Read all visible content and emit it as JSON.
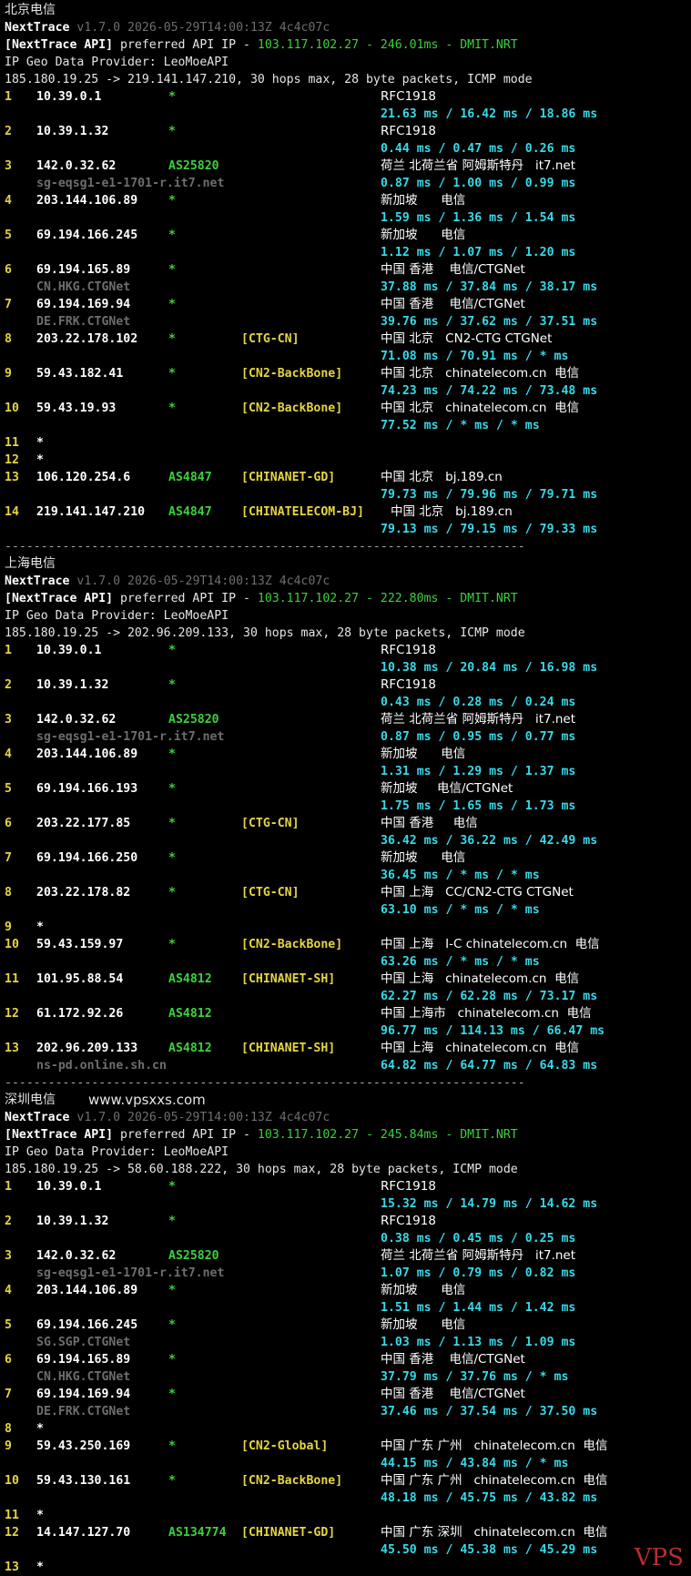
{
  "watermark_url": "www.vpsxxs.com",
  "watermark_brand": "VPS",
  "sections": [
    {
      "label": "北京电信",
      "version": "v1.7.0 2026-05-29T14:00:13Z 4c4c07c",
      "api_ip": "103.117.102.27",
      "api_latency": "246.01ms",
      "api_pop": "DMIT.NRT",
      "provider": "IP Geo Data Provider: LeoMoeAPI",
      "target": "185.180.19.25 -> 219.141.147.210, 30 hops max, 28 byte packets, ICMP mode",
      "hops": [
        {
          "n": "1",
          "ip": "10.39.0.1",
          "as": "*",
          "tag": "",
          "geo": "RFC1918",
          "rdns": "",
          "rtt": "21.63 ms / 16.42 ms / 18.86 ms"
        },
        {
          "n": "2",
          "ip": "10.39.1.32",
          "as": "*",
          "tag": "",
          "geo": "RFC1918",
          "rdns": "",
          "rtt": "0.44 ms / 0.47 ms / 0.26 ms"
        },
        {
          "n": "3",
          "ip": "142.0.32.62",
          "as": "AS25820",
          "tag": "",
          "geo": "荷兰 北荷兰省 阿姆斯特丹   it7.net",
          "rdns": "sg-eqsg1-e1-1701-r.it7.net",
          "rtt": "0.87 ms / 1.00 ms / 0.99 ms"
        },
        {
          "n": "4",
          "ip": "203.144.106.89",
          "as": "*",
          "tag": "",
          "geo": "新加坡      电信",
          "rdns": "",
          "rtt": "1.59 ms / 1.36 ms / 1.54 ms"
        },
        {
          "n": "5",
          "ip": "69.194.166.245",
          "as": "*",
          "tag": "",
          "geo": "新加坡      电信",
          "rdns": "",
          "rtt": "1.12 ms / 1.07 ms / 1.20 ms"
        },
        {
          "n": "6",
          "ip": "69.194.165.89",
          "as": "*",
          "tag": "",
          "geo": "中国 香港    电信/CTGNet",
          "rdns": "CN.HKG.CTGNet",
          "rtt": "37.88 ms / 37.84 ms / 38.17 ms"
        },
        {
          "n": "7",
          "ip": "69.194.169.94",
          "as": "*",
          "tag": "",
          "geo": "中国 香港    电信/CTGNet",
          "rdns": "DE.FRK.CTGNet",
          "rtt": "39.76 ms / 37.62 ms / 37.51 ms"
        },
        {
          "n": "8",
          "ip": "203.22.178.102",
          "as": "*",
          "tag": "[CTG-CN]",
          "geo": "中国 北京   CN2-CTG CTGNet",
          "rdns": "",
          "rtt": "71.08 ms / 70.91 ms / * ms"
        },
        {
          "n": "9",
          "ip": "59.43.182.41",
          "as": "*",
          "tag": "[CN2-BackBone]",
          "geo": "中国 北京   chinatelecom.cn  电信",
          "rdns": "",
          "rtt": "74.23 ms / 74.22 ms / 73.48 ms"
        },
        {
          "n": "10",
          "ip": "59.43.19.93",
          "as": "*",
          "tag": "[CN2-BackBone]",
          "geo": "中国 北京   chinatelecom.cn  电信",
          "rdns": "",
          "rtt": "77.52 ms / * ms / * ms"
        },
        {
          "n": "11",
          "ip": "*",
          "as": "",
          "tag": "",
          "geo": "",
          "rdns": "",
          "rtt": ""
        },
        {
          "n": "12",
          "ip": "*",
          "as": "",
          "tag": "",
          "geo": "",
          "rdns": "",
          "rtt": ""
        },
        {
          "n": "13",
          "ip": "106.120.254.6",
          "as": "AS4847",
          "tag": "[CHINANET-GD]",
          "geo": "中国 北京   bj.189.cn",
          "rdns": "",
          "rtt": "79.73 ms / 79.96 ms / 79.71 ms"
        },
        {
          "n": "14",
          "ip": "219.141.147.210",
          "as": "AS4847",
          "tag": "[CHINATELECOM-BJ]",
          "geo": "中国 北京   bj.189.cn",
          "rdns": "",
          "rtt": "79.13 ms / 79.15 ms / 79.33 ms"
        }
      ]
    },
    {
      "label": "上海电信",
      "version": "v1.7.0 2026-05-29T14:00:13Z 4c4c07c",
      "api_ip": "103.117.102.27",
      "api_latency": "222.80ms",
      "api_pop": "DMIT.NRT",
      "provider": "IP Geo Data Provider: LeoMoeAPI",
      "target": "185.180.19.25 -> 202.96.209.133, 30 hops max, 28 byte packets, ICMP mode",
      "hops": [
        {
          "n": "1",
          "ip": "10.39.0.1",
          "as": "*",
          "tag": "",
          "geo": "RFC1918",
          "rdns": "",
          "rtt": "10.38 ms / 20.84 ms / 16.98 ms"
        },
        {
          "n": "2",
          "ip": "10.39.1.32",
          "as": "*",
          "tag": "",
          "geo": "RFC1918",
          "rdns": "",
          "rtt": "0.43 ms / 0.28 ms / 0.24 ms"
        },
        {
          "n": "3",
          "ip": "142.0.32.62",
          "as": "AS25820",
          "tag": "",
          "geo": "荷兰 北荷兰省 阿姆斯特丹   it7.net",
          "rdns": "sg-eqsg1-e1-1701-r.it7.net",
          "rtt": "0.87 ms / 0.95 ms / 0.77 ms"
        },
        {
          "n": "4",
          "ip": "203.144.106.89",
          "as": "*",
          "tag": "",
          "geo": "新加坡      电信",
          "rdns": "",
          "rtt": "1.31 ms / 1.29 ms / 1.37 ms"
        },
        {
          "n": "5",
          "ip": "69.194.166.193",
          "as": "*",
          "tag": "",
          "geo": "新加坡     电信/CTGNet",
          "rdns": "",
          "rtt": "1.75 ms / 1.65 ms / 1.73 ms"
        },
        {
          "n": "6",
          "ip": "203.22.177.85",
          "as": "*",
          "tag": "[CTG-CN]",
          "geo": "中国 香港     电信",
          "rdns": "",
          "rtt": "36.42 ms / 36.22 ms / 42.49 ms"
        },
        {
          "n": "7",
          "ip": "69.194.166.250",
          "as": "*",
          "tag": "",
          "geo": "新加坡      电信",
          "rdns": "",
          "rtt": "36.45 ms / * ms / * ms"
        },
        {
          "n": "8",
          "ip": "203.22.178.82",
          "as": "*",
          "tag": "[CTG-CN]",
          "geo": "中国 上海   CC/CN2-CTG CTGNet",
          "rdns": "",
          "rtt": "63.10 ms / * ms / * ms"
        },
        {
          "n": "9",
          "ip": "*",
          "as": "",
          "tag": "",
          "geo": "",
          "rdns": "",
          "rtt": ""
        },
        {
          "n": "10",
          "ip": "59.43.159.97",
          "as": "*",
          "tag": "[CN2-BackBone]",
          "geo": "中国 上海   I-C chinatelecom.cn  电信",
          "rdns": "",
          "rtt": "63.26 ms / * ms / * ms"
        },
        {
          "n": "11",
          "ip": "101.95.88.54",
          "as": "AS4812",
          "tag": "[CHINANET-SH]",
          "geo": "中国 上海   chinatelecom.cn  电信",
          "rdns": "",
          "rtt": "62.27 ms / 62.28 ms / 73.17 ms"
        },
        {
          "n": "12",
          "ip": "61.172.92.26",
          "as": "AS4812",
          "tag": "",
          "geo": "中国 上海市   chinatelecom.cn  电信",
          "rdns": "",
          "rtt": "96.77 ms / 114.13 ms / 66.47 ms"
        },
        {
          "n": "13",
          "ip": "202.96.209.133",
          "as": "AS4812",
          "tag": "[CHINANET-SH]",
          "geo": "中国 上海   chinatelecom.cn  电信",
          "rdns": "ns-pd.online.sh.cn",
          "rtt": "64.82 ms / 64.77 ms / 64.83 ms"
        }
      ]
    },
    {
      "label": "深圳电信",
      "version": "v1.7.0 2026-05-29T14:00:13Z 4c4c07c",
      "api_ip": "103.117.102.27",
      "api_latency": "245.84ms",
      "api_pop": "DMIT.NRT",
      "provider": "IP Geo Data Provider: LeoMoeAPI",
      "target": "185.180.19.25 -> 58.60.188.222, 30 hops max, 28 byte packets, ICMP mode",
      "hops": [
        {
          "n": "1",
          "ip": "10.39.0.1",
          "as": "*",
          "tag": "",
          "geo": "RFC1918",
          "rdns": "",
          "rtt": "15.32 ms / 14.79 ms / 14.62 ms"
        },
        {
          "n": "2",
          "ip": "10.39.1.32",
          "as": "*",
          "tag": "",
          "geo": "RFC1918",
          "rdns": "",
          "rtt": "0.38 ms / 0.45 ms / 0.25 ms"
        },
        {
          "n": "3",
          "ip": "142.0.32.62",
          "as": "AS25820",
          "tag": "",
          "geo": "荷兰 北荷兰省 阿姆斯特丹   it7.net",
          "rdns": "sg-eqsg1-e1-1701-r.it7.net",
          "rtt": "1.07 ms / 0.79 ms / 0.82 ms"
        },
        {
          "n": "4",
          "ip": "203.144.106.89",
          "as": "*",
          "tag": "",
          "geo": "新加坡      电信",
          "rdns": "",
          "rtt": "1.51 ms / 1.44 ms / 1.42 ms"
        },
        {
          "n": "5",
          "ip": "69.194.166.245",
          "as": "*",
          "tag": "",
          "geo": "新加坡      电信",
          "rdns": "SG.SGP.CTGNet",
          "rtt": "1.03 ms / 1.13 ms / 1.09 ms"
        },
        {
          "n": "6",
          "ip": "69.194.165.89",
          "as": "*",
          "tag": "",
          "geo": "中国 香港    电信/CTGNet",
          "rdns": "CN.HKG.CTGNet",
          "rtt": "37.79 ms / 37.76 ms / * ms"
        },
        {
          "n": "7",
          "ip": "69.194.169.94",
          "as": "*",
          "tag": "",
          "geo": "中国 香港    电信/CTGNet",
          "rdns": "DE.FRK.CTGNet",
          "rtt": "37.46 ms / 37.54 ms / 37.50 ms"
        },
        {
          "n": "8",
          "ip": "*",
          "as": "",
          "tag": "",
          "geo": "",
          "rdns": "",
          "rtt": ""
        },
        {
          "n": "9",
          "ip": "59.43.250.169",
          "as": "*",
          "tag": "[CN2-Global]",
          "geo": "中国 广东 广州   chinatelecom.cn  电信",
          "rdns": "",
          "rtt": "44.15 ms / 43.84 ms / * ms"
        },
        {
          "n": "10",
          "ip": "59.43.130.161",
          "as": "*",
          "tag": "[CN2-BackBone]",
          "geo": "中国 广东 广州   chinatelecom.cn  电信",
          "rdns": "",
          "rtt": "48.18 ms / 45.75 ms / 43.82 ms"
        },
        {
          "n": "11",
          "ip": "*",
          "as": "",
          "tag": "",
          "geo": "",
          "rdns": "",
          "rtt": ""
        },
        {
          "n": "12",
          "ip": "14.147.127.70",
          "as": "AS134774",
          "tag": "[CHINANET-GD]",
          "geo": "中国 广东 深圳   chinatelecom.cn  电信",
          "rdns": "",
          "rtt": "45.50 ms / 45.38 ms / 45.29 ms"
        },
        {
          "n": "13",
          "ip": "*",
          "as": "",
          "tag": "",
          "geo": "",
          "rdns": "",
          "rtt": ""
        }
      ]
    }
  ],
  "ui": {
    "app_name": "NextTrace",
    "api_label": "[NextTrace API]",
    "api_text": " preferred API IP - ",
    "dash": " - ",
    "separator": "------------------------------------------------------------------------"
  }
}
